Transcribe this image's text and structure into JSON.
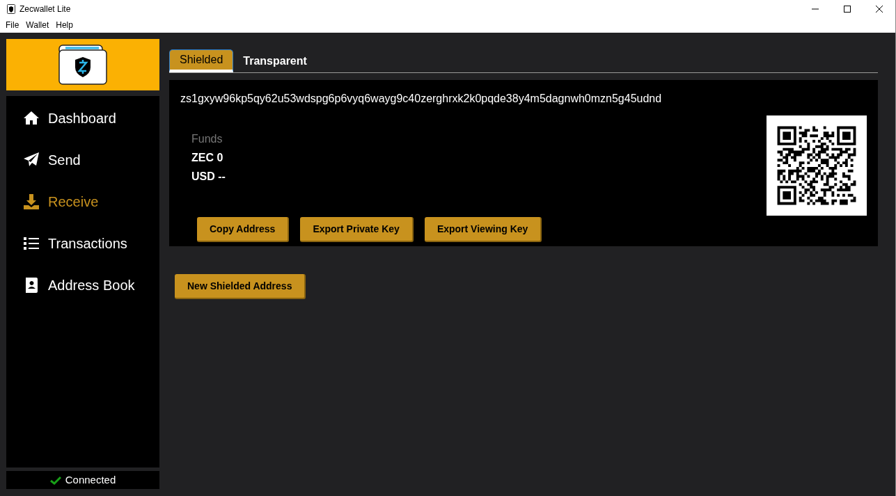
{
  "window": {
    "title": "Zecwallet Lite"
  },
  "menu": [
    "File",
    "Wallet",
    "Help"
  ],
  "sidebar": {
    "items": [
      {
        "label": "Dashboard",
        "selected": false
      },
      {
        "label": "Send",
        "selected": false
      },
      {
        "label": "Receive",
        "selected": true
      },
      {
        "label": "Transactions",
        "selected": false
      },
      {
        "label": "Address Book",
        "selected": false
      }
    ],
    "status": "Connected"
  },
  "tabs": [
    {
      "label": "Shielded",
      "selected": true
    },
    {
      "label": "Transparent",
      "selected": false
    }
  ],
  "address_card": {
    "address": "zs1gxyw96kp5qy62u53wdspg6p6vyq6wayg9c40zerghrxk2k0pqde38y4m5dagnwh0mzn5g45udnd",
    "funds_label": "Funds",
    "zec": "ZEC 0",
    "usd": "USD --",
    "buttons": [
      "Copy Address",
      "Export Private Key",
      "Export Viewing Key"
    ]
  },
  "new_address_button": "New Shielded Address"
}
